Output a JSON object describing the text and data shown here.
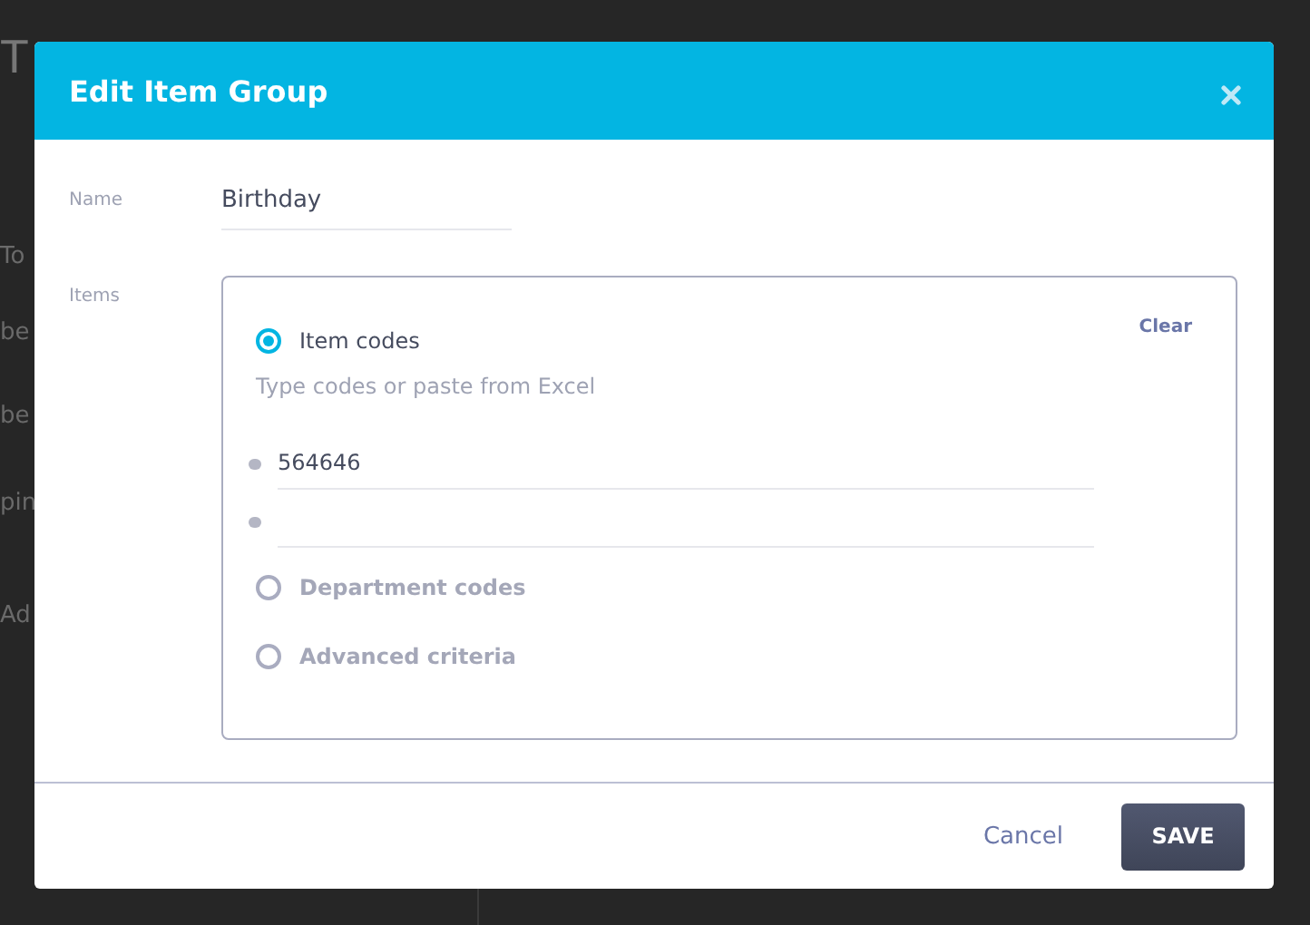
{
  "background": {
    "title": "T",
    "rows": [
      "To",
      "be",
      "be",
      "pin",
      "Ad"
    ]
  },
  "modal": {
    "title": "Edit Item Group",
    "name": {
      "label": "Name",
      "value": "Birthday"
    },
    "items": {
      "label": "Items",
      "clear": "Clear",
      "hint": "Type codes or paste from Excel",
      "codes": [
        "564646"
      ],
      "options": [
        {
          "label": "Item codes",
          "selected": true
        },
        {
          "label": "Department codes",
          "selected": false
        },
        {
          "label": "Advanced criteria",
          "selected": false
        }
      ]
    },
    "cancel": "Cancel",
    "save": "SAVE"
  }
}
